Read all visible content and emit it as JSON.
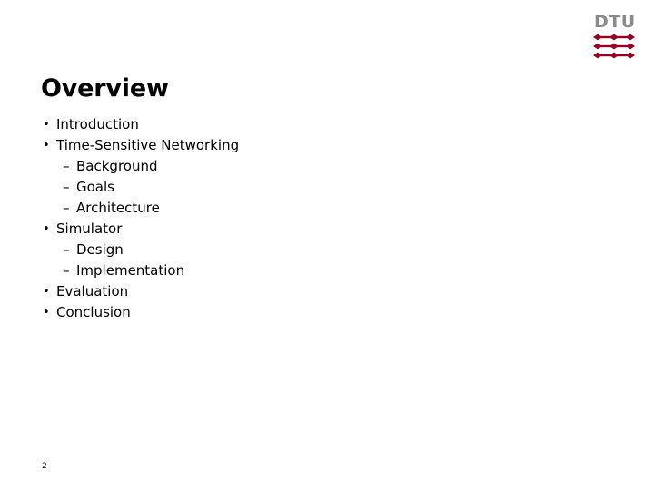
{
  "slide": {
    "title": "Overview",
    "page_number": "2",
    "background_color": "#ffffff",
    "text_color": "#000000"
  },
  "logo": {
    "wordmark": "DTU",
    "wordmark_color": "#8a8a8a",
    "mark_color": "#99001f",
    "rows": 3
  },
  "outline": {
    "items": [
      {
        "level": 1,
        "marker": "•",
        "label": "Introduction"
      },
      {
        "level": 1,
        "marker": "•",
        "label": "Time-Sensitive Networking"
      },
      {
        "level": 2,
        "marker": "–",
        "label": "Background"
      },
      {
        "level": 2,
        "marker": "–",
        "label": "Goals"
      },
      {
        "level": 2,
        "marker": "–",
        "label": "Architecture"
      },
      {
        "level": 1,
        "marker": "•",
        "label": "Simulator"
      },
      {
        "level": 2,
        "marker": "–",
        "label": "Design"
      },
      {
        "level": 2,
        "marker": "–",
        "label": "Implementation"
      },
      {
        "level": 1,
        "marker": "•",
        "label": "Evaluation"
      },
      {
        "level": 1,
        "marker": "•",
        "label": "Conclusion"
      }
    ]
  }
}
